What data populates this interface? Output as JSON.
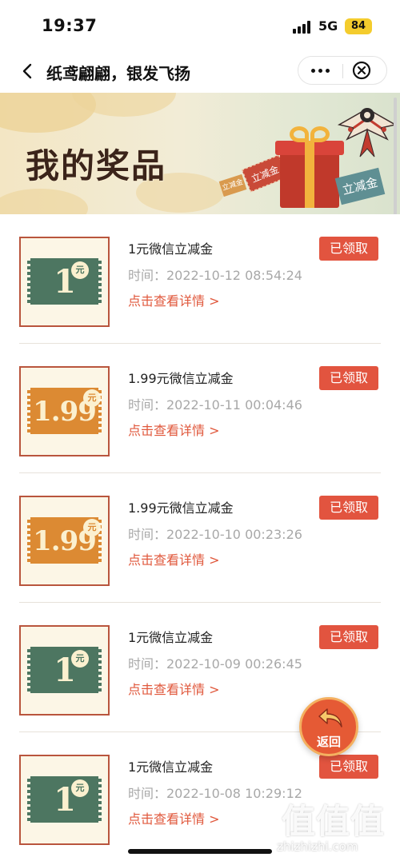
{
  "status_bar": {
    "time": "19:37",
    "network": "5G",
    "battery": "84"
  },
  "nav": {
    "title": "纸鸢翩翩，银发飞扬"
  },
  "banner": {
    "title": "我的奖品",
    "ticket_label": "立减金"
  },
  "prizes": [
    {
      "name": "1元微信立减金",
      "time": "时间：2022-10-12 08:54:24",
      "detail": "点击查看详情 >",
      "status": "已领取",
      "amount": "1",
      "unit": "元",
      "color": "#4d7661"
    },
    {
      "name": "1.99元微信立减金",
      "time": "时间：2022-10-11 00:04:46",
      "detail": "点击查看详情 >",
      "status": "已领取",
      "amount": "1.99",
      "unit": "元",
      "color": "#dc8a33"
    },
    {
      "name": "1.99元微信立减金",
      "time": "时间：2022-10-10 00:23:26",
      "detail": "点击查看详情 >",
      "status": "已领取",
      "amount": "1.99",
      "unit": "元",
      "color": "#dc8a33"
    },
    {
      "name": "1元微信立减金",
      "time": "时间：2022-10-09 00:26:45",
      "detail": "点击查看详情 >",
      "status": "已领取",
      "amount": "1",
      "unit": "元",
      "color": "#4d7661"
    },
    {
      "name": "1元微信立减金",
      "time": "时间：2022-10-08 10:29:12",
      "detail": "点击查看详情 >",
      "status": "已领取",
      "amount": "1",
      "unit": "元",
      "color": "#4d7661"
    }
  ],
  "float_button": {
    "label": "返回"
  },
  "watermark": {
    "logo": "值值值",
    "text": "zhizhizhi.com"
  },
  "colors": {
    "accent": "#e2543f",
    "link": "#e0583c",
    "card_border": "#b9553d"
  },
  "icons": {
    "back": "chevron-left-icon",
    "more": "more-dots-icon",
    "close": "circle-close-icon",
    "return": "return-arrow-icon"
  }
}
